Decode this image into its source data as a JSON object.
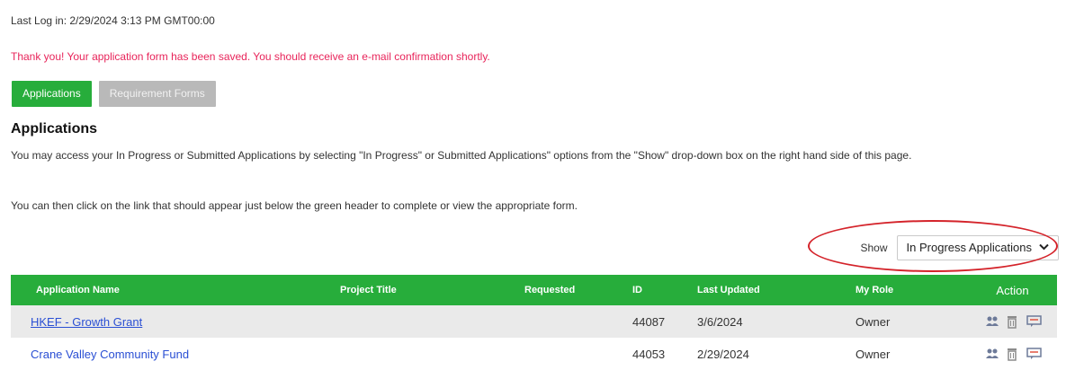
{
  "header": {
    "last_login": "Last Log in: 2/29/2024 3:13 PM GMT00:00",
    "confirmation": "Thank you! Your application form has been saved. You should receive an e-mail confirmation shortly."
  },
  "tabs": [
    {
      "label": "Applications"
    },
    {
      "label": "Requirement Forms"
    }
  ],
  "page": {
    "title": "Applications",
    "para1": "You may access your In Progress or Submitted Applications by selecting \"In Progress\" or Submitted Applications\" options from the \"Show\" drop-down box on the right hand side of this page.",
    "para2": "You can then click on the link that should appear just below the green header to complete or view the appropriate form."
  },
  "filter": {
    "label": "Show",
    "selected": "In Progress Applications"
  },
  "table": {
    "columns": [
      "Application Name",
      "Project Title",
      "Requested",
      "ID",
      "Last Updated",
      "My Role",
      "Action"
    ],
    "rows": [
      {
        "name": "HKEF - Growth Grant",
        "project": "",
        "requested": "",
        "id": "44087",
        "updated": "3/6/2024",
        "role": "Owner"
      },
      {
        "name": "Crane Valley Community Fund",
        "project": "",
        "requested": "",
        "id": "44053",
        "updated": "2/29/2024",
        "role": "Owner"
      }
    ]
  },
  "colors": {
    "accent_green": "#27ad3b",
    "alert_pink": "#e8245a",
    "link_blue": "#2a4fd4",
    "highlight_red": "#d4232a"
  },
  "icons": [
    "team-icon",
    "trash-icon",
    "comment-icon"
  ]
}
